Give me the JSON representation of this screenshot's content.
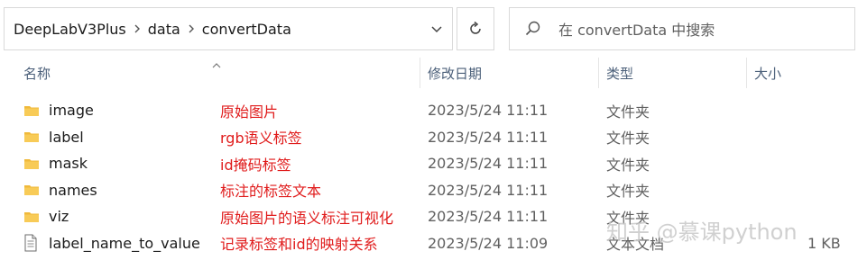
{
  "breadcrumb": [
    "DeepLabV3Plus",
    "data",
    "convertData"
  ],
  "search": {
    "placeholder": "在 convertData 中搜索"
  },
  "columns": {
    "name": "名称",
    "date": "修改日期",
    "type": "类型",
    "size": "大小"
  },
  "files": [
    {
      "name": "image",
      "icon": "folder-icon",
      "note": "原始图片",
      "date": "2023/5/24 11:11",
      "type": "文件夹",
      "size": ""
    },
    {
      "name": "label",
      "icon": "folder-icon",
      "note": "rgb语义标签",
      "date": "2023/5/24 11:11",
      "type": "文件夹",
      "size": ""
    },
    {
      "name": "mask",
      "icon": "folder-icon",
      "note": "id掩码标签",
      "date": "2023/5/24 11:11",
      "type": "文件夹",
      "size": ""
    },
    {
      "name": "names",
      "icon": "folder-icon",
      "note": "标注的标签文本",
      "date": "2023/5/24 11:11",
      "type": "文件夹",
      "size": ""
    },
    {
      "name": "viz",
      "icon": "folder-icon",
      "note": "原始图片的语义标注可视化",
      "date": "2023/5/24 11:11",
      "type": "文件夹",
      "size": ""
    },
    {
      "name": "label_name_to_value",
      "icon": "text-file-icon",
      "note": "记录标签和id的映射关系",
      "date": "2023/5/24 11:09",
      "type": "文本文档",
      "size": "1 KB"
    }
  ],
  "watermark": "知乎 @慕课python",
  "colors": {
    "folder": "#f0b93a",
    "note": "#e01b1b",
    "header_text": "#4c607a"
  }
}
